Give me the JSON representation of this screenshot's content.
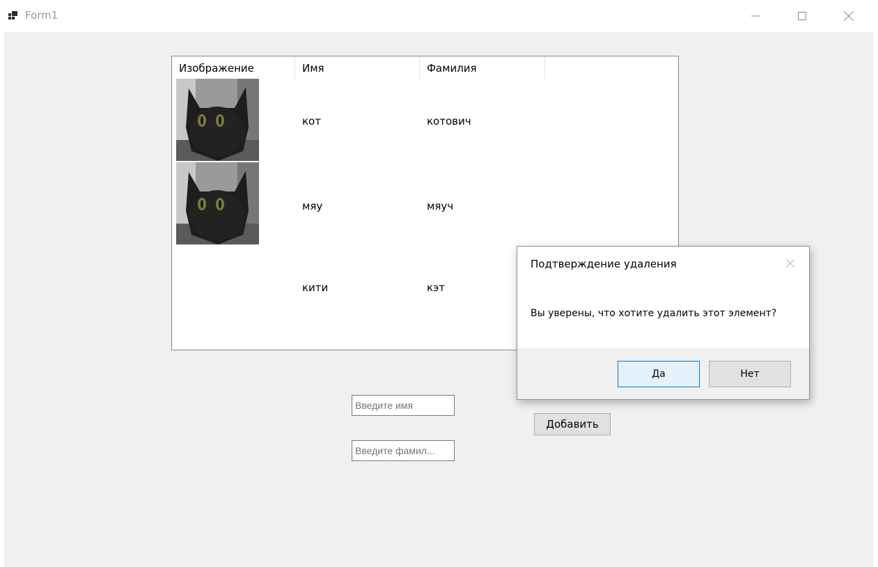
{
  "window": {
    "title": "Form1",
    "icon": "winforms-app-icon",
    "controls": [
      "minimize-icon",
      "maximize-icon",
      "close-icon"
    ]
  },
  "listview": {
    "columns": [
      "Изображение",
      "Имя",
      "Фамилия"
    ],
    "rows": [
      {
        "has_image": true,
        "image": "black-cat-photo",
        "name": "кот",
        "surname": "котович"
      },
      {
        "has_image": true,
        "image": "black-cat-photo",
        "name": "мяу",
        "surname": "мяуч"
      },
      {
        "has_image": false,
        "name": "кити",
        "surname": "кэт"
      }
    ]
  },
  "form": {
    "name_placeholder": "Введите имя",
    "surname_placeholder": "Введите фамил...",
    "add_label": "Добавить"
  },
  "dialog": {
    "title": "Подтверждение удаления",
    "message": "Вы уверены, что хотите удалить этот элемент?",
    "yes_label": "Да",
    "no_label": "Нет"
  },
  "colors": {
    "client_bg": "#f0f0f0",
    "accent": "#0078d7",
    "default_button_bg": "#e5f1fb"
  }
}
